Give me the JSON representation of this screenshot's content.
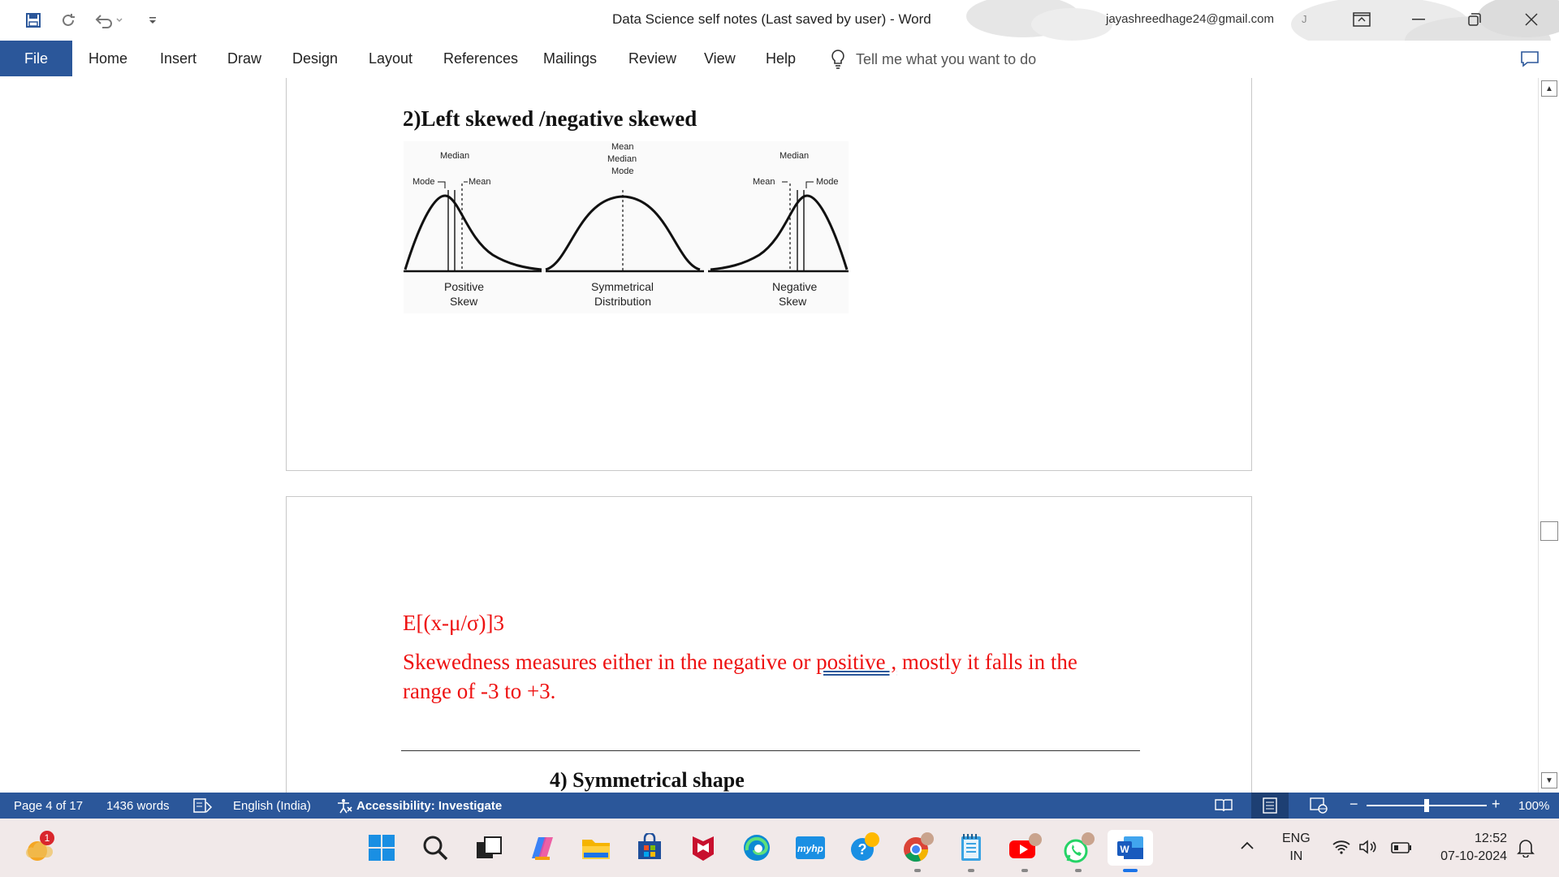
{
  "titlebar": {
    "document_title": "Data Science self notes (Last saved by user)  -  Word",
    "account_email": "jayashreedhage24@gmail.com",
    "account_initial": "J",
    "quick_access": [
      "save-icon",
      "autosave-icon",
      "undo-icon",
      "customize-icon"
    ]
  },
  "ribbon": {
    "tabs": [
      "File",
      "Home",
      "Insert",
      "Draw",
      "Design",
      "Layout",
      "References",
      "Mailings",
      "Review",
      "View",
      "Help"
    ],
    "tell_me": "Tell me what you want to do"
  },
  "document": {
    "heading_skew": "2)Left skewed /negative skewed",
    "figure": {
      "left": {
        "top_label": "Median",
        "left_label": "Mode",
        "right_label": "Mean",
        "caption_line1": "Positive",
        "caption_line2": "Skew"
      },
      "middle": {
        "top_line1": "Mean",
        "top_line2": "Median",
        "top_line3": "Mode",
        "caption_line1": "Symmetrical",
        "caption_line2": "Distribution"
      },
      "right": {
        "top_label": "Median",
        "left_label": "Mean",
        "right_label": "Mode",
        "caption_line1": "Negative",
        "caption_line2": "Skew"
      }
    },
    "formula": "E[(x-μ/σ)]3",
    "para_before": " Skewedness measures either in the negative or ",
    "para_link": "positive ,",
    "para_after": " mostly it falls in the range of -3 to +3.",
    "heading_sym": "4)  Symmetrical shape"
  },
  "statusbar": {
    "page": "Page 4 of 17",
    "words": "1436 words",
    "language": "English (India)",
    "accessibility": "Accessibility: Investigate",
    "zoom": "100%",
    "zoom_level": 0.5
  },
  "taskbar": {
    "weather_badge": "1",
    "apps": [
      "windows-start",
      "search",
      "task-view",
      "copilot",
      "file-explorer",
      "microsoft-store",
      "mcafee",
      "edge",
      "myhp",
      "get-help",
      "chrome",
      "notepad",
      "youtube",
      "whatsapp",
      "word"
    ],
    "language_line1": "ENG",
    "language_line2": "IN",
    "time": "12:52",
    "date": "07-10-2024"
  },
  "colors": {
    "word_blue": "#2b579a",
    "red_text": "#ee1111",
    "taskbar_bg": "#f1e9e9"
  }
}
